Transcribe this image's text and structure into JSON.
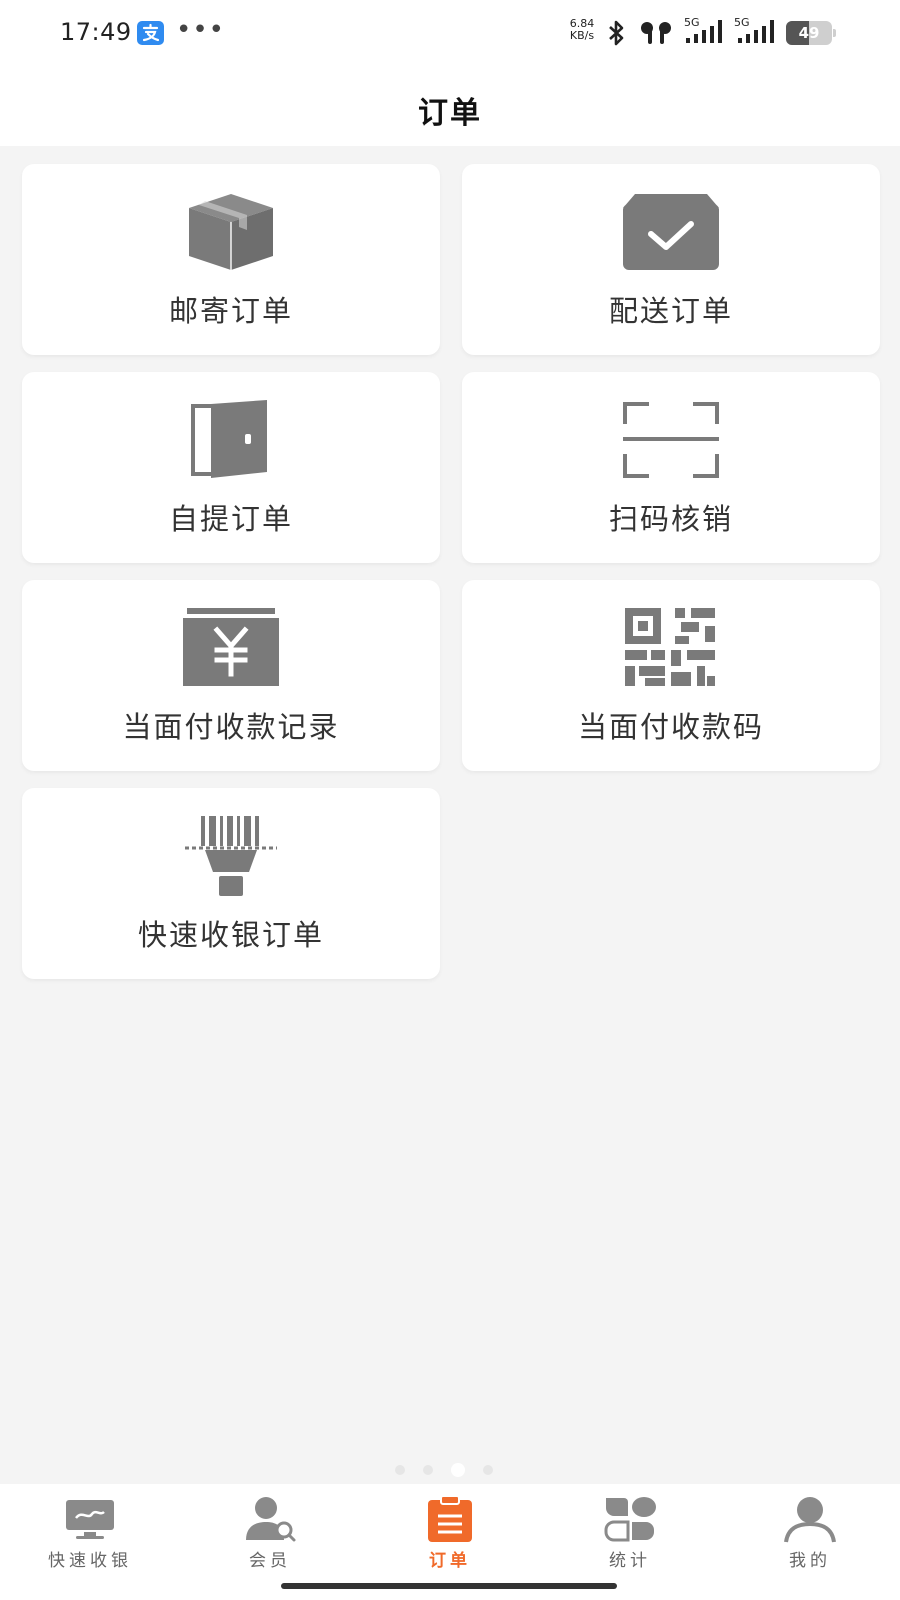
{
  "status_bar": {
    "time": "17:49",
    "more": "•••",
    "net_speed_value": "6.84",
    "net_speed_unit": "KB/s",
    "signal_label_1": "5G",
    "signal_label_2": "5G",
    "battery_level": "49",
    "battery_fraction": 0.49
  },
  "header": {
    "title": "订单"
  },
  "grid": {
    "items": [
      {
        "label": "邮寄订单",
        "icon": "package-box-icon"
      },
      {
        "label": "配送订单",
        "icon": "delivery-check-box-icon"
      },
      {
        "label": "自提订单",
        "icon": "door-icon"
      },
      {
        "label": "扫码核销",
        "icon": "scan-frame-icon"
      },
      {
        "label": "当面付收款记录",
        "icon": "yuan-payment-icon"
      },
      {
        "label": "当面付收款码",
        "icon": "qr-code-icon"
      },
      {
        "label": "快速收银订单",
        "icon": "barcode-scanner-icon"
      }
    ]
  },
  "bottom_nav": {
    "items": [
      {
        "label": "快速收银",
        "icon": "monitor-icon",
        "active": false
      },
      {
        "label": "会员",
        "icon": "member-icon",
        "active": false
      },
      {
        "label": "订单",
        "icon": "order-clipboard-icon",
        "active": true
      },
      {
        "label": "统计",
        "icon": "statistics-icon",
        "active": false
      },
      {
        "label": "我的",
        "icon": "profile-icon",
        "active": false
      }
    ]
  },
  "colors": {
    "accent": "#f06a2a",
    "icon_gray": "#7a7a7a",
    "background": "#f4f4f4",
    "card": "#ffffff"
  }
}
